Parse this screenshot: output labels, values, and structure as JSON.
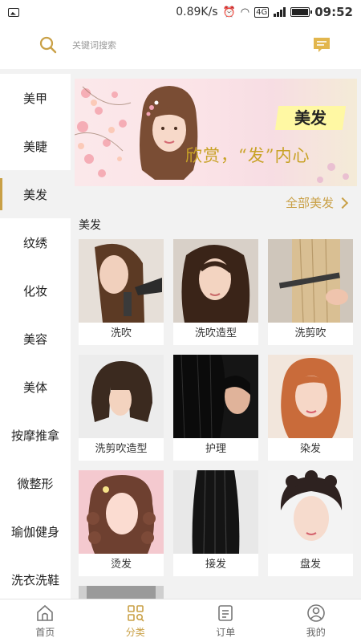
{
  "status_bar": {
    "speed": "0.89K/s",
    "time": "09:52",
    "network": "4G"
  },
  "search": {
    "placeholder": "关键词搜索"
  },
  "sidebar": {
    "items": [
      {
        "label": "美甲"
      },
      {
        "label": "美睫"
      },
      {
        "label": "美发"
      },
      {
        "label": "纹绣"
      },
      {
        "label": "化妆"
      },
      {
        "label": "美容"
      },
      {
        "label": "美体"
      },
      {
        "label": "按摩推拿"
      },
      {
        "label": "微整形"
      },
      {
        "label": "瑜伽健身"
      },
      {
        "label": "洗衣洗鞋"
      }
    ],
    "active": "美发"
  },
  "banner": {
    "tag": "美发",
    "slogan": "欣赏，“发”内心"
  },
  "section": {
    "link": "全部美发",
    "title": "美发"
  },
  "categories": [
    {
      "label": "洗吹"
    },
    {
      "label": "洗吹造型"
    },
    {
      "label": "洗剪吹"
    },
    {
      "label": "洗剪吹造型"
    },
    {
      "label": "护理"
    },
    {
      "label": "染发"
    },
    {
      "label": "烫发"
    },
    {
      "label": "接发"
    },
    {
      "label": "盘发"
    }
  ],
  "tabbar": {
    "items": [
      {
        "label": "首页"
      },
      {
        "label": "分类"
      },
      {
        "label": "订单"
      },
      {
        "label": "我的"
      }
    ],
    "active": "分类"
  },
  "colors": {
    "accent": "#c9a046",
    "background": "#f2f2f2",
    "banner_slogan": "#c8a226"
  }
}
